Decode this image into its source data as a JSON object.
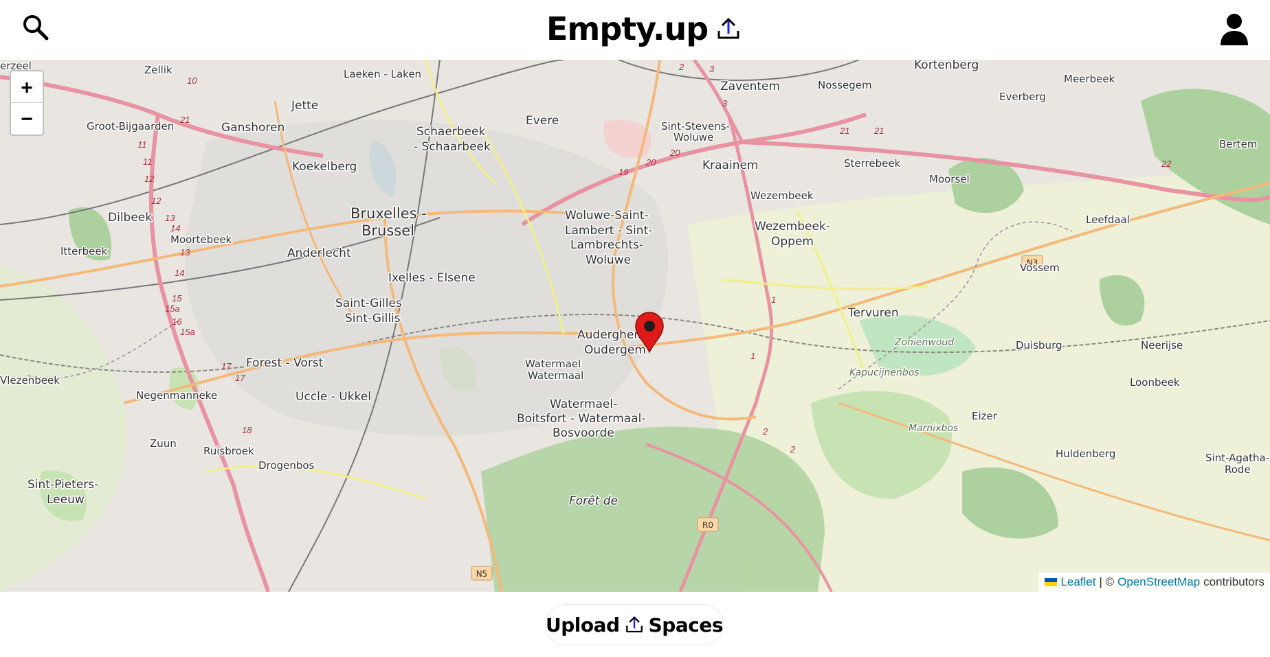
{
  "header": {
    "title": "Empty.up",
    "icons": {
      "search": "search-icon",
      "upload": "upload-icon",
      "account": "user-icon"
    }
  },
  "map": {
    "zoom_in_label": "+",
    "zoom_out_label": "−",
    "marker_icon": "map-pin-icon",
    "marker_color": "#e01919",
    "attribution": {
      "leaflet": "Leaflet",
      "separator": "| ©",
      "osm": "OpenStreetMap",
      "contributors": "contributors"
    },
    "place_labels": [
      "Zellik",
      "Laeken - Laken",
      "Evere",
      "Zaventem",
      "Nossegem",
      "Kortenberg",
      "Meerbeek",
      "Jette",
      "Ganshoren",
      "Groot-Bijgaarden",
      "Schaerbeek",
      "- Schaarbeek",
      "Everberg",
      "Sint-Stevens-",
      "Woluwe",
      "Bertem",
      "Koekelberg",
      "Kraainem",
      "Sterrebeek",
      "Moorsel",
      "Wezembeek",
      "Dilbeek",
      "Bruxelles -",
      "Brussel",
      "Woluwe-Saint-",
      "Lambert - Sint-",
      "Lambrechts-",
      "Woluwe",
      "Wezembeek-",
      "Oppem",
      "Leefdaal",
      "Itterbeek",
      "Moortebeek",
      "Anderlecht",
      "Ixelles - Elsene",
      "Vossem",
      "Saint-Gilles",
      "Sint-Gillis",
      "Tervuren",
      "Auderghem",
      "Oudergem",
      "Duisburg",
      "Neerijse",
      "Forest - Vorst",
      "Watermael",
      "Watermaal",
      "Vlezenbeek",
      "Negenmanneke",
      "Uccle - Ukkel",
      "Loonbeek",
      "Watermael-",
      "Boitsfort - Watermaal-",
      "Bosvoorde",
      "Eizer",
      "Zuun",
      "Ruisbroek",
      "Drogenbos",
      "Huldenberg",
      "Sint-Agatha-",
      "Rode",
      "Sint-Pieters-",
      "Leeuw",
      "erzeel",
      "Forêt de"
    ],
    "forest_labels": [
      "Zonienwoud",
      "Kapucijnenbos",
      "Marnixbos"
    ],
    "road_shields": [
      "N3",
      "R0",
      "N5"
    ],
    "colors": {
      "background": "#eaeaea",
      "forest": "#add19e",
      "motorway": "#e892a2",
      "primary": "#fcd6a4",
      "secondary": "#f7fabf"
    }
  },
  "footer": {
    "upload_label": "Upload",
    "spaces_label": "Spaces",
    "icon": "upload-icon"
  }
}
